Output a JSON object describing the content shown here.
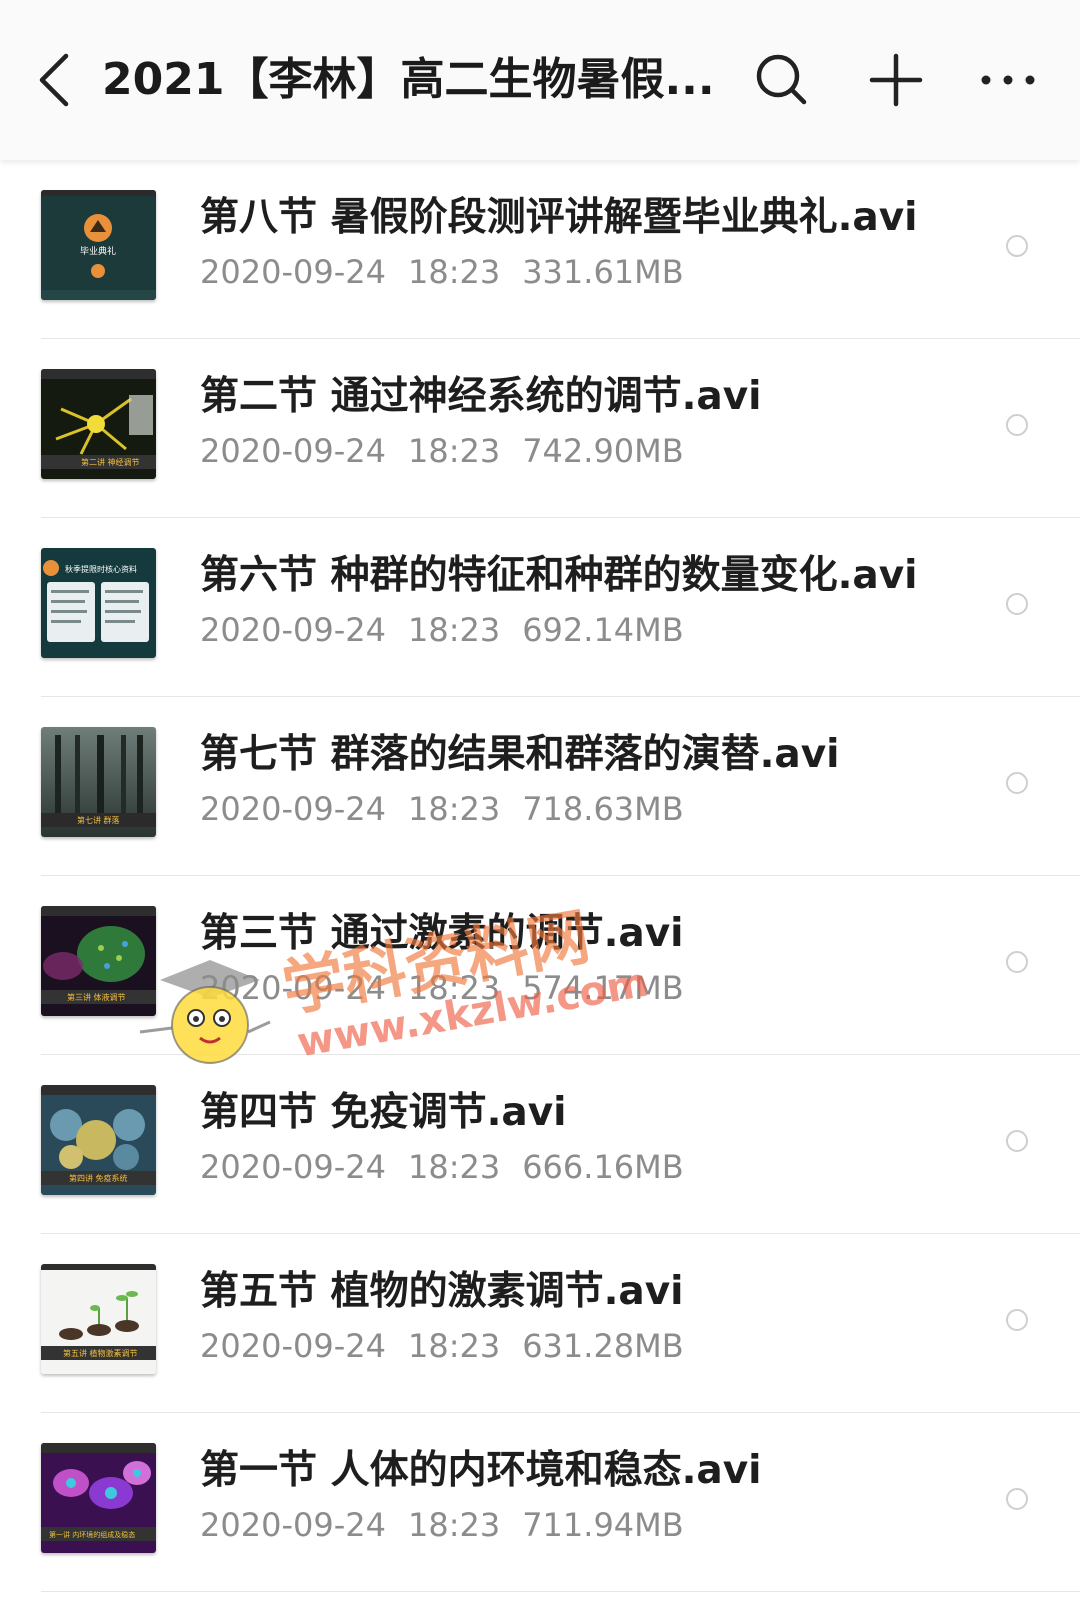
{
  "header": {
    "title": "2021【李林】高二生物暑假...",
    "icons": [
      "back-icon",
      "search-icon",
      "add-icon",
      "more-icon"
    ]
  },
  "files": [
    {
      "name": "第八节 暑假阶段测评讲解暨毕业典礼.avi",
      "date": "2020-09-24",
      "time": "18:23",
      "size": "331.61MB",
      "thumb_text": "毕业典礼"
    },
    {
      "name": "第二节 通过神经系统的调节.avi",
      "date": "2020-09-24",
      "time": "18:23",
      "size": "742.90MB",
      "thumb_text": "第二讲 神经调节"
    },
    {
      "name": "第六节 种群的特征和种群的数量变化.avi",
      "date": "2020-09-24",
      "time": "18:23",
      "size": "692.14MB",
      "thumb_text": "秋季提限时核心资料"
    },
    {
      "name": "第七节 群落的结果和群落的演替.avi",
      "date": "2020-09-24",
      "time": "18:23",
      "size": "718.63MB",
      "thumb_text": "第七讲 群落"
    },
    {
      "name": "第三节 通过激素的调节.avi",
      "date": "2020-09-24",
      "time": "18:23",
      "size": "574.17MB",
      "thumb_text": "第三讲 体液调节"
    },
    {
      "name": "第四节 免疫调节.avi",
      "date": "2020-09-24",
      "time": "18:23",
      "size": "666.16MB",
      "thumb_text": "第四讲 免疫系统"
    },
    {
      "name": "第五节 植物的激素调节.avi",
      "date": "2020-09-24",
      "time": "18:23",
      "size": "631.28MB",
      "thumb_text": "第五讲 植物激素调节"
    },
    {
      "name": "第一节 人体的内环境和稳态.avi",
      "date": "2020-09-24",
      "time": "18:23",
      "size": "711.94MB",
      "thumb_text": "第一讲 内环境的组成及稳态"
    }
  ],
  "watermark": {
    "text1": "学科资料网",
    "text2": "www.xkzlw.com"
  }
}
